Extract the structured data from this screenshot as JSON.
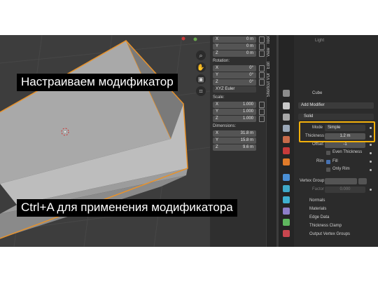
{
  "captions": {
    "top": "Настраиваем модификатор",
    "bottom": "Ctrl+A для применения модификатора"
  },
  "npanel": {
    "location_rows": [
      {
        "axis": "X",
        "value": "0 m"
      },
      {
        "axis": "Y",
        "value": "0 m"
      },
      {
        "axis": "Z",
        "value": "0 m"
      }
    ],
    "rotation_label": "Rotation:",
    "rotation_rows": [
      {
        "axis": "X",
        "value": "0°"
      },
      {
        "axis": "Y",
        "value": "0°"
      },
      {
        "axis": "Z",
        "value": "0°"
      }
    ],
    "mode_label": "XYZ Euler",
    "scale_label": "Scale:",
    "scale_rows": [
      {
        "axis": "X",
        "value": "1.000"
      },
      {
        "axis": "Y",
        "value": "1.000"
      },
      {
        "axis": "Z",
        "value": "1.000"
      }
    ],
    "dimensions_label": "Dimensions:",
    "dimensions_rows": [
      {
        "axis": "X",
        "value": "31.8 m"
      },
      {
        "axis": "Y",
        "value": "15.8 m"
      },
      {
        "axis": "Z",
        "value": "9.6 m"
      }
    ]
  },
  "tabs": [
    "Tool",
    "View",
    "Edit",
    "Shortcut VUr"
  ],
  "properties": {
    "light_label": "Light",
    "object_name": "Cube",
    "add_modifier": "Add Modifier",
    "modifier_name": "Solid",
    "mode_label": "Mode",
    "mode_value": "Simple",
    "thickness_label": "Thickness",
    "thickness_value": "1.2 m",
    "offset_label": "Offset",
    "offset_value": "-1",
    "even_thickness": "Even Thickness",
    "rim_label": "Rim",
    "fill_label": "Fill",
    "rim_only": "Only Rim",
    "vertex_group_label": "Vertex Group",
    "factor_label": "Factor",
    "factor_value": "0.000",
    "sections": [
      "Normals",
      "Materials",
      "Edge Data",
      "Thickness Clamp",
      "Output Vertex Groups"
    ]
  },
  "colors": {
    "highlight": "#f2b00b",
    "selection_outline": "#e8922a",
    "checkbox_on": "#4772b3"
  }
}
